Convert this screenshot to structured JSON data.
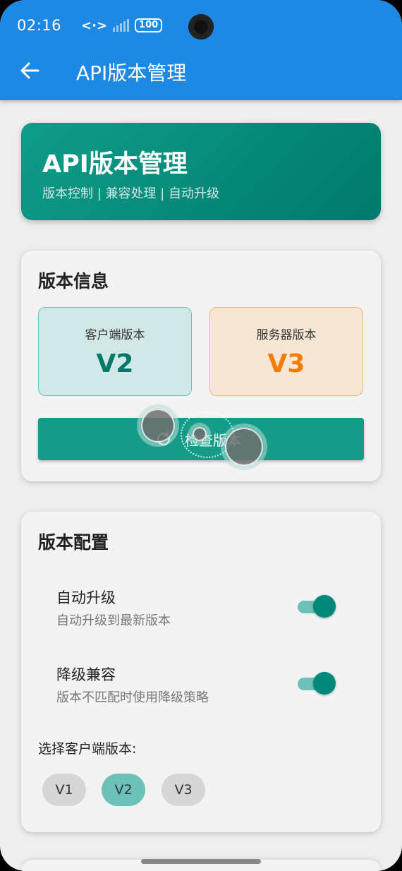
{
  "status_bar": {
    "time": "02:16",
    "network": "<·>",
    "battery": "100"
  },
  "app_bar": {
    "title": "API版本管理"
  },
  "hero": {
    "title": "API版本管理",
    "subtitle": "版本控制 | 兼容处理 | 自动升级"
  },
  "version_info": {
    "title": "版本信息",
    "client": {
      "label": "客户端版本",
      "value": "V2"
    },
    "server": {
      "label": "服务器版本",
      "value": "V3"
    },
    "check_button": "检查版本"
  },
  "version_config": {
    "title": "版本配置",
    "auto_upgrade": {
      "title": "自动升级",
      "subtitle": "自动升级到最新版本",
      "enabled": true
    },
    "downgrade_compat": {
      "title": "降级兼容",
      "subtitle": "版本不匹配时使用降级策略",
      "enabled": true
    },
    "select_label": "选择客户端版本:",
    "options": [
      "V1",
      "V2",
      "V3"
    ],
    "selected": "V2"
  },
  "colors": {
    "app_bar": "#1e88e5",
    "primary": "#00897b",
    "accent_orange": "#f57c00"
  },
  "icons": {
    "back": "arrow-left-icon",
    "refresh": "refresh-icon"
  }
}
